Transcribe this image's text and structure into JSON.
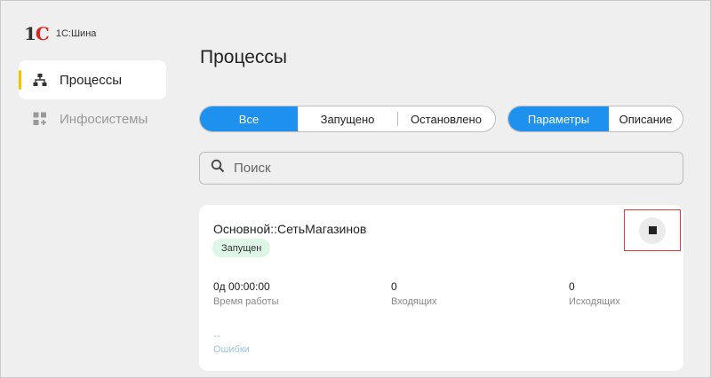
{
  "app": {
    "logo_mark": "1С",
    "product_name": "1С:Шина"
  },
  "sidebar": {
    "items": [
      {
        "label": "Процессы",
        "icon": "hierarchy-icon",
        "active": true
      },
      {
        "label": "Инфосистемы",
        "icon": "grid-plus-icon",
        "active": false
      }
    ]
  },
  "main": {
    "title": "Процессы",
    "state_filter": [
      "Все",
      "Запущено",
      "Остановлено"
    ],
    "state_filter_selected": "Все",
    "view_tabs": [
      "Параметры",
      "Описание"
    ],
    "view_tabs_selected": "Параметры",
    "search": {
      "placeholder": "Поиск",
      "value": ""
    },
    "process": {
      "name": "Основной::СетьМагазинов",
      "status": "Запущен",
      "metrics": [
        {
          "value": "0д 00:00:00",
          "label": "Время работы"
        },
        {
          "value": "0",
          "label": "Входящих"
        },
        {
          "value": "0",
          "label": "Исходящих"
        }
      ],
      "errors": {
        "value": "--",
        "label": "Ошибки"
      }
    }
  },
  "colors": {
    "accent": "#1e90ee",
    "status_bg": "#ddf6e5",
    "highlight": "#d43b3b",
    "active_marker": "#f2c200"
  }
}
